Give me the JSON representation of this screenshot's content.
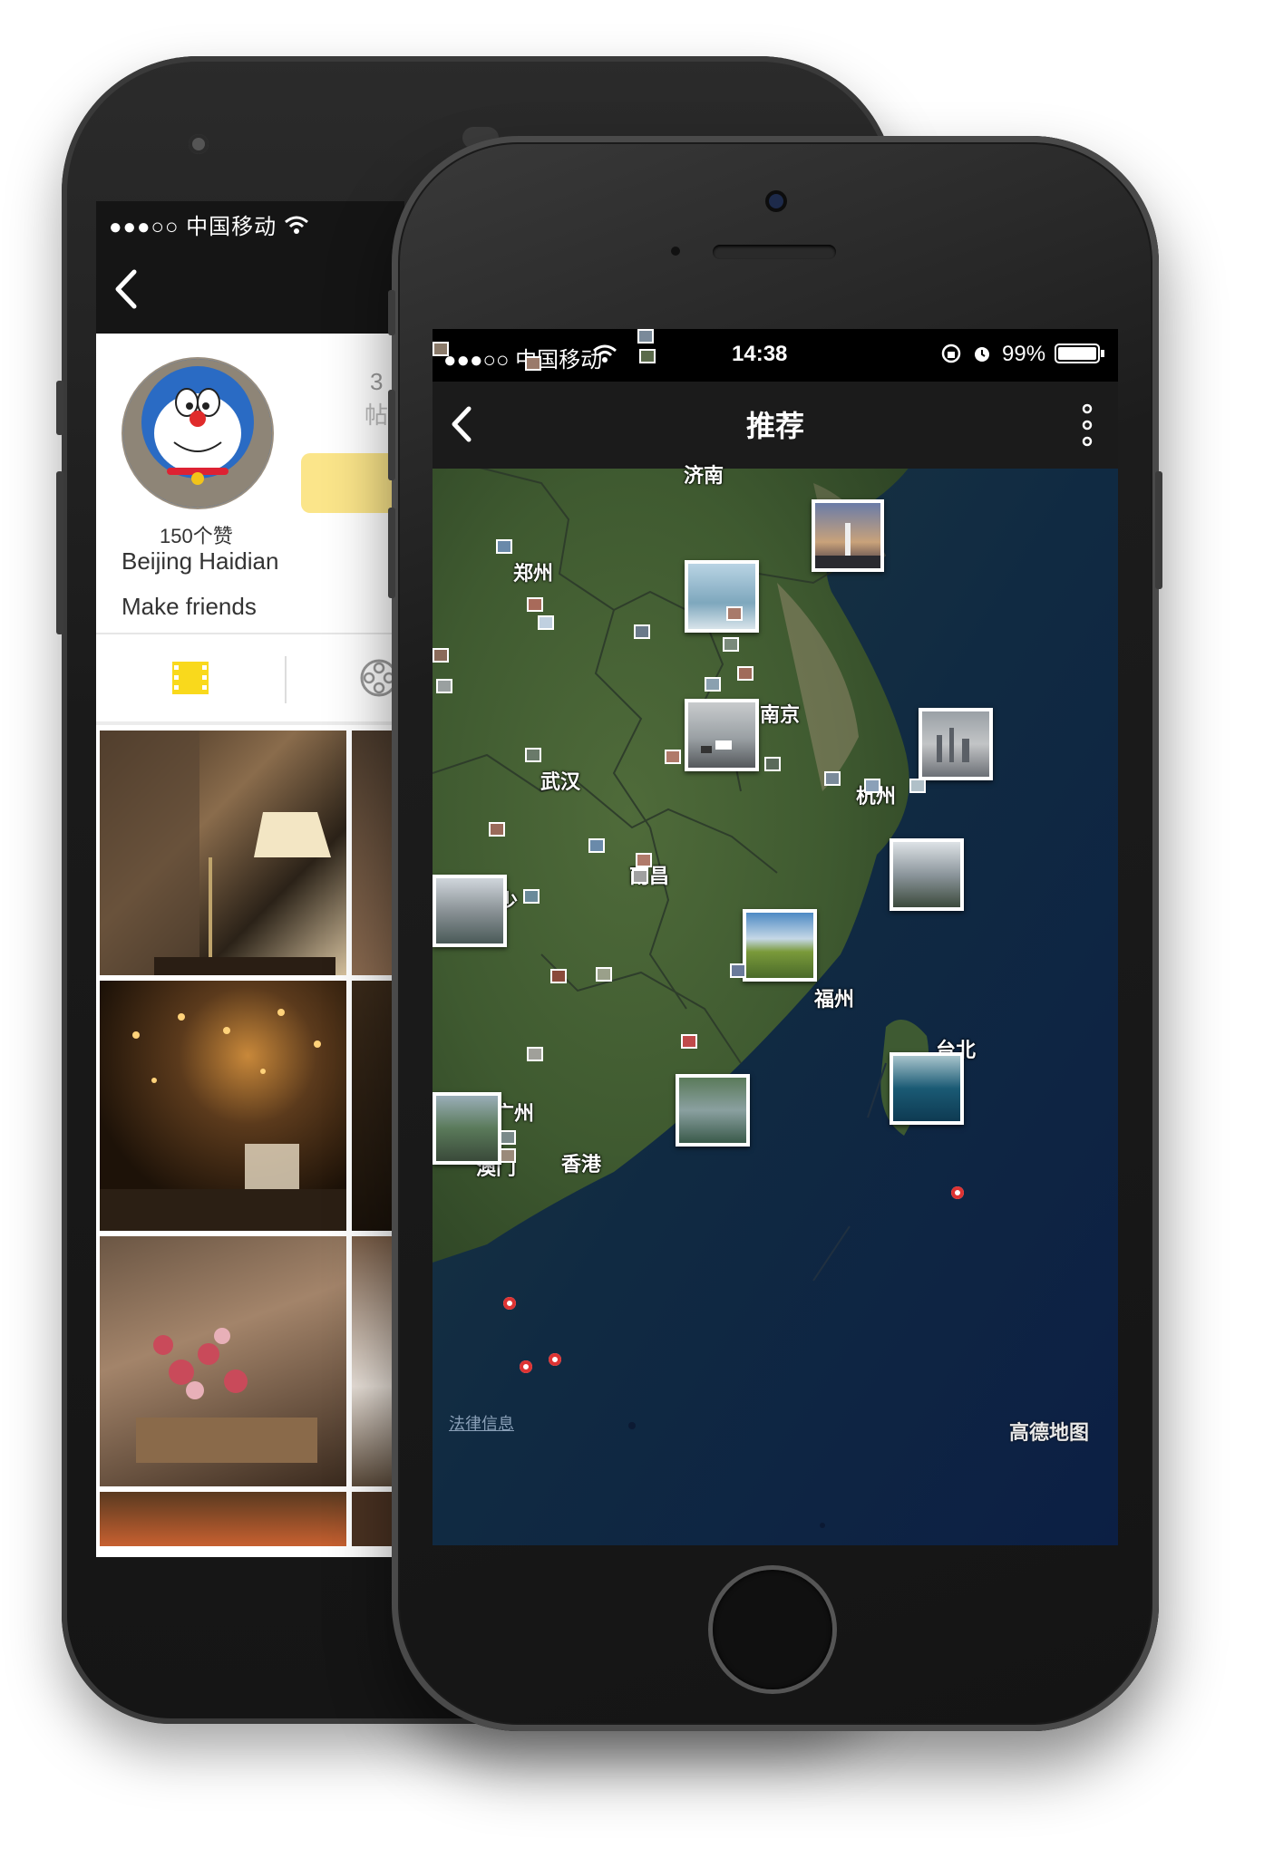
{
  "back_phone": {
    "status_text": "●●●○○ 中国移动",
    "profile": {
      "likes": "150个赞",
      "location": "Beijing Haidian",
      "intent": "Make friends",
      "stat_number": "3",
      "stat_label": "帖"
    }
  },
  "front_phone": {
    "status": {
      "carrier": "●●●○○ 中国移动",
      "time": "14:38",
      "battery": "99%"
    },
    "nav": {
      "title": "推荐"
    },
    "map": {
      "cities": [
        "济南",
        "郑州",
        "南京",
        "武汉",
        "杭州",
        "南昌",
        "福州",
        "台北",
        "广州",
        "澳门",
        "香港",
        "少"
      ],
      "legal": "法律信息",
      "provider": "高德地图"
    }
  },
  "colors": {
    "accent": "#fbe58a",
    "tab_active": "#f9d91c",
    "nav_bg": "#1b1b1b",
    "pin": "#d33333"
  },
  "icons": [
    "back-icon",
    "wifi-icon",
    "lock-rotation-icon",
    "alarm-icon",
    "battery-icon",
    "more-icon",
    "photo-tab-icon",
    "film-tab-icon"
  ]
}
